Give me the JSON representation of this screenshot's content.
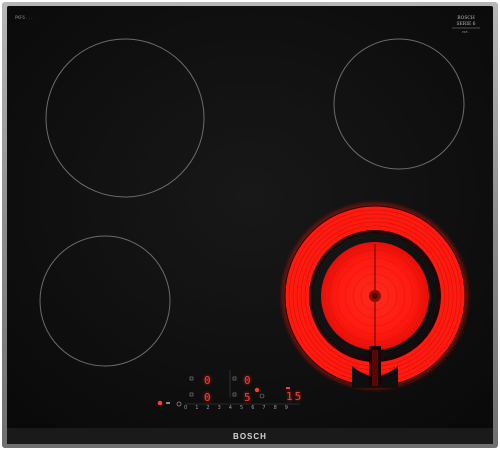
{
  "product": {
    "brand": "BOSCH",
    "model_label": "PKF6...",
    "badge_lines": [
      "BOSCH",
      "SERIE 6",
      "PKF..."
    ]
  },
  "zones": [
    {
      "name": "rear-left",
      "state": "off"
    },
    {
      "name": "rear-right",
      "state": "off"
    },
    {
      "name": "front-left",
      "state": "off"
    },
    {
      "name": "front-right-dual",
      "state": "on",
      "glow_color": "#ff1a10"
    }
  ],
  "control_panel": {
    "displays": [
      {
        "id": "rear-left",
        "value": "0"
      },
      {
        "id": "rear-right",
        "value": "0"
      },
      {
        "id": "front-left",
        "value": "0"
      },
      {
        "id": "front-right",
        "value": "5"
      }
    ],
    "timer_display": "15",
    "power_scale": [
      "0",
      "1",
      "2",
      "3",
      "4",
      "5",
      "6",
      "7",
      "8",
      "9"
    ]
  },
  "colors": {
    "glass": "#0e0e0e",
    "frame": "#8d8d8d",
    "zone_outline": "#6b6b6b",
    "indicator": "#ff3a2e",
    "heat": "#ff1a10"
  }
}
